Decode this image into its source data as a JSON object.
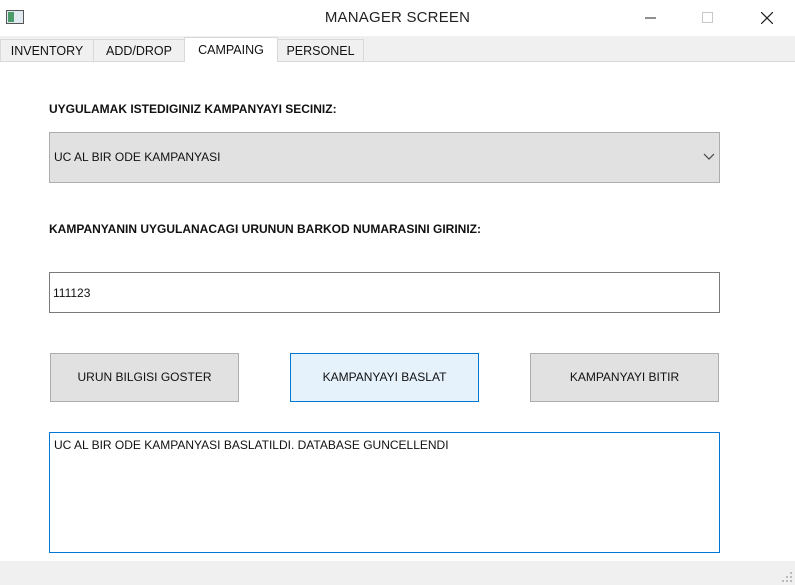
{
  "window": {
    "title": "MANAGER SCREEN",
    "icons": {
      "app": "app-window-icon",
      "minimize": "minimize-icon",
      "maximize": "maximize-icon",
      "close": "close-icon"
    }
  },
  "tabs": [
    {
      "label": "INVENTORY",
      "active": false
    },
    {
      "label": "ADD/DROP",
      "active": false
    },
    {
      "label": "CAMPAING",
      "active": true
    },
    {
      "label": "PERSONEL",
      "active": false
    }
  ],
  "campaign": {
    "select_label": "UYGULAMAK ISTEDIGINIZ KAMPANYAYI SECINIZ:",
    "selected_campaign": "UC AL BIR ODE KAMPANYASI",
    "barcode_label": "KAMPANYANIN UYGULANACAGI URUNUN BARKOD NUMARASINI GIRINIZ:",
    "barcode_value": "111123",
    "buttons": {
      "show_info": "URUN BILGISI GOSTER",
      "start": "KAMPANYAYI BASLAT",
      "end": "KAMPANYAYI BITIR"
    },
    "output_text": "UC AL BIR ODE KAMPANYASI BASLATILDI. DATABASE GUNCELLENDI"
  },
  "colors": {
    "accent": "#0078d7",
    "button_face": "#e1e1e1",
    "button_hover": "#e5f1fb"
  }
}
